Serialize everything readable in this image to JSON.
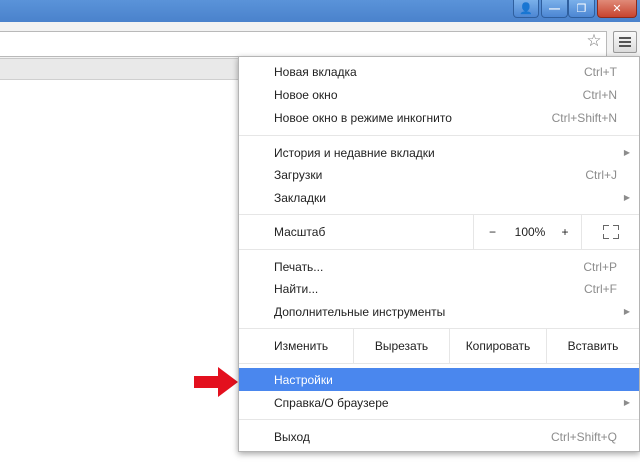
{
  "window_controls": {
    "profile": "👤",
    "minimize": "—",
    "restore": "❐",
    "close": "✕"
  },
  "toolbar": {
    "star": "☆"
  },
  "menu": {
    "group1": [
      {
        "label": "Новая вкладка",
        "shortcut": "Ctrl+T"
      },
      {
        "label": "Новое окно",
        "shortcut": "Ctrl+N"
      },
      {
        "label": "Новое окно в режиме инкогнито",
        "shortcut": "Ctrl+Shift+N"
      }
    ],
    "group2": [
      {
        "label": "История и недавние вкладки",
        "submenu": "▶"
      },
      {
        "label": "Загрузки",
        "shortcut": "Ctrl+J"
      },
      {
        "label": "Закладки",
        "submenu": "▶"
      }
    ],
    "zoom": {
      "label": "Масштаб",
      "minus": "−",
      "value": "100%",
      "plus": "+"
    },
    "group3": [
      {
        "label": "Печать...",
        "shortcut": "Ctrl+P"
      },
      {
        "label": "Найти...",
        "shortcut": "Ctrl+F"
      },
      {
        "label": "Дополнительные инструменты",
        "submenu": "▶"
      }
    ],
    "edit": {
      "label": "Изменить",
      "cut": "Вырезать",
      "copy": "Копировать",
      "paste": "Вставить"
    },
    "group4": [
      {
        "label": "Настройки",
        "highlighted": true
      },
      {
        "label": "Справка/О браузере",
        "submenu": "▶"
      }
    ],
    "exit": {
      "label": "Выход",
      "shortcut": "Ctrl+Shift+Q"
    }
  },
  "colors": {
    "highlight": "#4a87ee",
    "arrow": "#e3101e",
    "titlebar": "#4a82cc"
  }
}
